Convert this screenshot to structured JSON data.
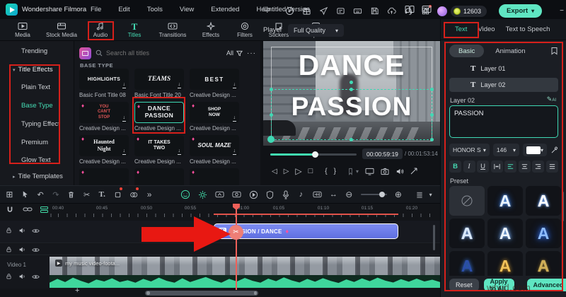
{
  "topbar": {
    "app_name": "Wondershare Filmora",
    "menus": [
      "File",
      "Edit",
      "Tools",
      "View",
      "Extended",
      "Help",
      "Version"
    ],
    "project_title": "Untitled",
    "coin_count": "12603",
    "export_label": "Export"
  },
  "tabbar": {
    "tabs": [
      "Media",
      "Stock Media",
      "Audio",
      "Titles",
      "Transitions",
      "Effects",
      "Filters",
      "Stickers",
      "Templates"
    ]
  },
  "player": {
    "label": "Player",
    "quality": "Full Quality",
    "overlay_line1": "DANCE",
    "overlay_line2": "PASSION",
    "time_current": "00:00:59:19",
    "time_total": "/ 00:01:53:14"
  },
  "sidebar": {
    "trending": "Trending",
    "effects_group": "Title Effects",
    "children": [
      "Plain Text",
      "Base Type",
      "Typing Effect",
      "Premium",
      "Glow Text"
    ],
    "templates_group": "Title Templates"
  },
  "library": {
    "search_placeholder": "Search all titles",
    "filter_all": "All",
    "section_header": "BASE TYPE",
    "items": [
      {
        "art": "HIGHLIGHTS",
        "name": "Basic Font Title 08"
      },
      {
        "art": "TEAMS",
        "name": "Basic Font Title 20"
      },
      {
        "art": "BEST",
        "name": "Creative Design ..."
      },
      {
        "art": "YOU CAN'T STOP",
        "name": "Creative Design ..."
      },
      {
        "art": "DANCE PASSION",
        "name": "Creative Design ..."
      },
      {
        "art": "SHOP NOW",
        "name": "Creative Design ..."
      },
      {
        "art": "Haunted Night",
        "name": "Creative Design ..."
      },
      {
        "art": "IT TAKES TWO",
        "name": "Creative Design ..."
      },
      {
        "art": "SOUL MAZE",
        "name": "Creative Design ..."
      }
    ]
  },
  "rightpanel": {
    "tabs": [
      "Text",
      "Video",
      "Text to Speech"
    ],
    "subtabs": [
      "Basic",
      "Animation"
    ],
    "layers": [
      "Layer 01",
      "Layer 02"
    ],
    "layer_label": "Layer 02",
    "text_value": "PASSION",
    "font_name": "HONOR S",
    "font_size": "146",
    "bold": "B",
    "italic": "I",
    "underline": "U",
    "preset_label": "Preset",
    "preset_glyph": "A",
    "reset_label": "Reset",
    "apply_label": "Apply to All",
    "advanced_label": "Advanced"
  },
  "timeline": {
    "ruler": [
      "00:40",
      "00:45",
      "00:50",
      "00:55",
      "01:00",
      "01:05",
      "01:10",
      "01:15",
      "01:20"
    ],
    "clip_label": "PASSION / DANCE",
    "video_track_label": "Video 1",
    "video_clip_name": "my music video-foota...",
    "watermark": "wtvid.com"
  }
}
